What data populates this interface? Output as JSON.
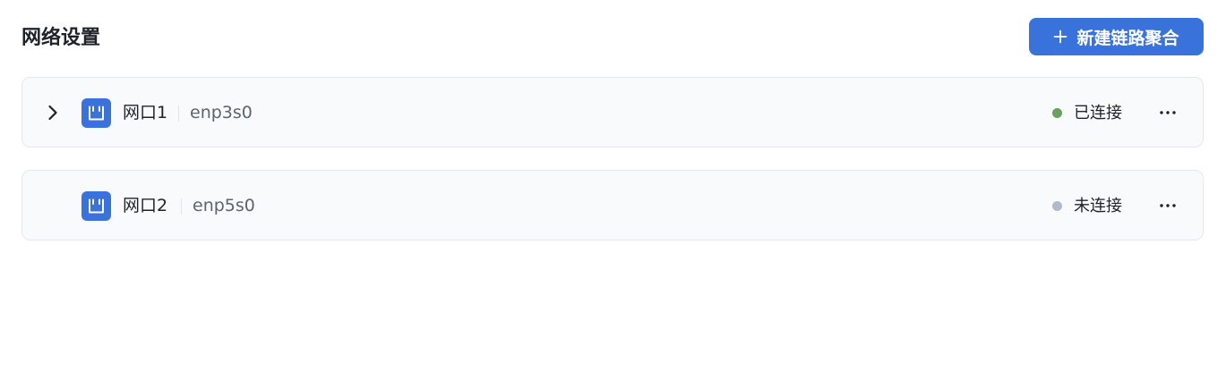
{
  "header": {
    "title": "网络设置",
    "create_button_label": "新建链路聚合"
  },
  "colors": {
    "accent": "#3a72db",
    "connected": "#6aa05f",
    "disconnected": "#b0bac9"
  },
  "ports": [
    {
      "name": "网口1",
      "interface": "enp3s0",
      "status": "已连接",
      "status_color": "#6aa05f",
      "expandable": true
    },
    {
      "name": "网口2",
      "interface": "enp5s0",
      "status": "未连接",
      "status_color": "#b0bac9",
      "expandable": false
    }
  ]
}
